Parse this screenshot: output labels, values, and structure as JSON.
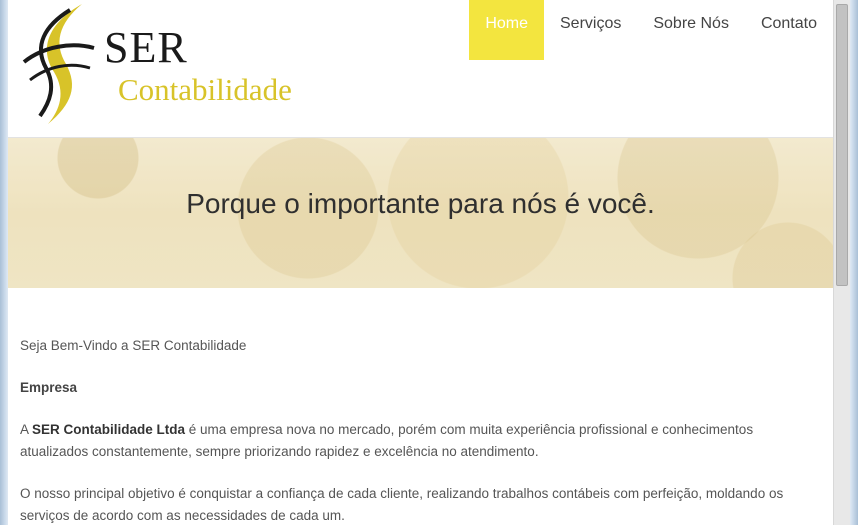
{
  "logo": {
    "title": "SER",
    "subtitle": "Contabilidade",
    "accent_color": "#d8c329"
  },
  "nav": {
    "items": [
      {
        "label": "Home",
        "active": true
      },
      {
        "label": "Serviços",
        "active": false
      },
      {
        "label": "Sobre Nós",
        "active": false
      },
      {
        "label": "Contato",
        "active": false
      }
    ],
    "active_color": "#f3e53f"
  },
  "hero": {
    "title": "Porque o importante para nós é você."
  },
  "content": {
    "welcome": "Seja Bem-Vindo a SER Contabilidade",
    "heading": "Empresa",
    "para1_prefix": "A ",
    "para1_bold": "SER Contabilidade Ltda",
    "para1_text": " é uma empresa nova no mercado, porém com muita experiência profissional e conhecimentos atualizados constantemente, sempre priorizando rapidez e excelência no atendimento.",
    "para2": "O nosso principal objetivo é conquistar a confiança de cada cliente, realizando trabalhos contábeis com perfeição, moldando os serviços de acordo com as necessidades de cada um."
  }
}
